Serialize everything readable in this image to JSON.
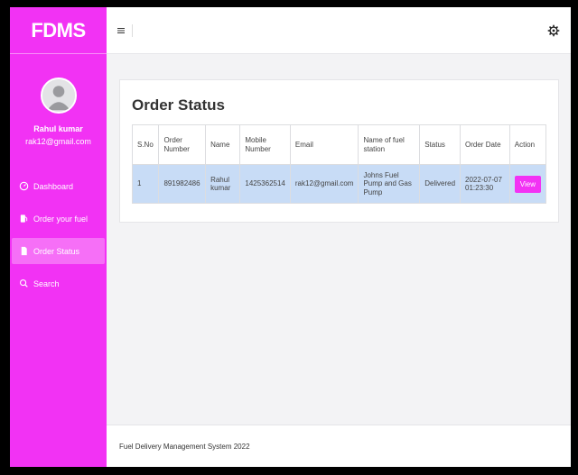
{
  "brand": "FDMS",
  "user": {
    "name": "Rahul kumar",
    "email": "rak12@gmail.com"
  },
  "nav": [
    {
      "label": "Dashboard",
      "icon": "gauge-icon",
      "active": false
    },
    {
      "label": "Order your fuel",
      "icon": "fuel-pump-icon",
      "active": false
    },
    {
      "label": "Order Status",
      "icon": "document-icon",
      "active": true
    },
    {
      "label": "Search",
      "icon": "search-icon",
      "active": false
    }
  ],
  "topbar": {
    "menu_icon": "hamburger-icon",
    "settings_icon": "gear-icon"
  },
  "page": {
    "title": "Order Status",
    "table": {
      "headers": [
        "S.No",
        "Order Number",
        "Name",
        "Mobile Number",
        "Email",
        "Name of fuel station",
        "Status",
        "Order Date",
        "Action"
      ],
      "rows": [
        [
          "1",
          "891982486",
          "Rahul kumar",
          "1425362514",
          "rak12@gmail.com",
          "Johns Fuel Pump and Gas Pump",
          "Delivered",
          "2022-07-07 01:23:30",
          "View"
        ]
      ]
    }
  },
  "footer": "Fuel Delivery Management System 2022",
  "colors": {
    "accent": "#f232f4",
    "row_highlight": "#c8dcf6"
  }
}
